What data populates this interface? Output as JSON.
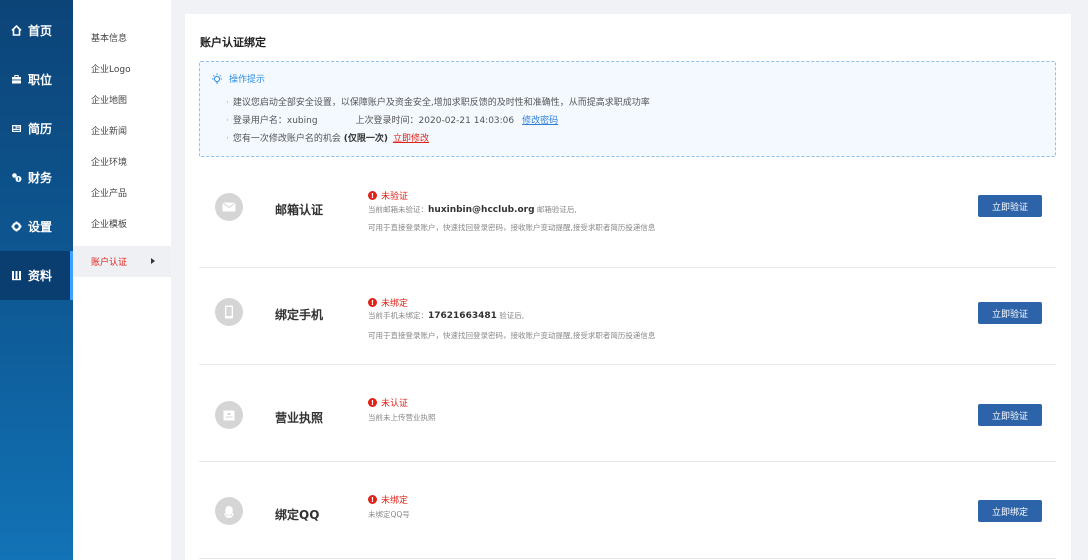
{
  "nav": {
    "items": [
      {
        "label": "首页",
        "icon": "home-icon"
      },
      {
        "label": "职位",
        "icon": "briefcase-icon"
      },
      {
        "label": "简历",
        "icon": "resume-icon"
      },
      {
        "label": "财务",
        "icon": "finance-icon"
      },
      {
        "label": "设置",
        "icon": "gear-icon"
      },
      {
        "label": "资料",
        "icon": "profile-icon"
      }
    ],
    "active_index": 5
  },
  "subnav": {
    "items": [
      "基本信息",
      "企业Logo",
      "企业地图",
      "企业新闻",
      "企业环境",
      "企业产品",
      "企业模板",
      "账户认证"
    ],
    "active_index": 7
  },
  "page": {
    "title": "账户认证绑定"
  },
  "tips": {
    "heading": "操作提示",
    "line1": "建议您启动全部安全设置，以保障账户及资金安全,增加求职反馈的及时性和准确性，从而提高求职成功率",
    "username_label": "登录用户名：xubing",
    "last_login_label": "上次登录时间：2020-02-21 14:03:06",
    "change_password_link": "修改密码",
    "rename_prefix": "您有一次修改账户名的机会",
    "rename_bold": "(仅限一次)",
    "rename_link": "立即修改"
  },
  "verifications": [
    {
      "name": "邮箱认证",
      "icon": "envelope-icon",
      "status": "未验证",
      "desc1_prefix": "当前邮箱未验证：",
      "desc1_value": "huxinbin@hcclub.org",
      "desc1_suffix": " 邮箱验证后,",
      "desc2": "可用于直接登录账户，快速找回登录密码，接收账户变动提醒,接受求职者简历投递信息",
      "button": "立即验证"
    },
    {
      "name": "绑定手机",
      "icon": "phone-icon",
      "status": "未绑定",
      "desc1_prefix": "当前手机未绑定：",
      "desc1_value": "17621663481",
      "desc1_suffix": " 验证后,",
      "desc2": "可用于直接登录账户，快速找回登录密码，接收账户变动提醒,接受求职者简历投递信息",
      "button": "立即验证"
    },
    {
      "name": "营业执照",
      "icon": "license-icon",
      "status": "未认证",
      "desc1_prefix": "当前未上传营业执照",
      "desc1_value": "",
      "desc1_suffix": "",
      "desc2": "",
      "button": "立即验证"
    },
    {
      "name": "绑定QQ",
      "icon": "qq-icon",
      "status": "未绑定",
      "desc1_prefix": "未绑定QQ号",
      "desc1_value": "",
      "desc1_suffix": "",
      "desc2": "",
      "button": "立即绑定"
    }
  ],
  "colors": {
    "sidebar_top": "#0c4478",
    "sidebar_bottom": "#1273b6",
    "accent_blue": "#2d63a8",
    "alert_red": "#e0231a",
    "link_blue": "#2f7fd8"
  }
}
